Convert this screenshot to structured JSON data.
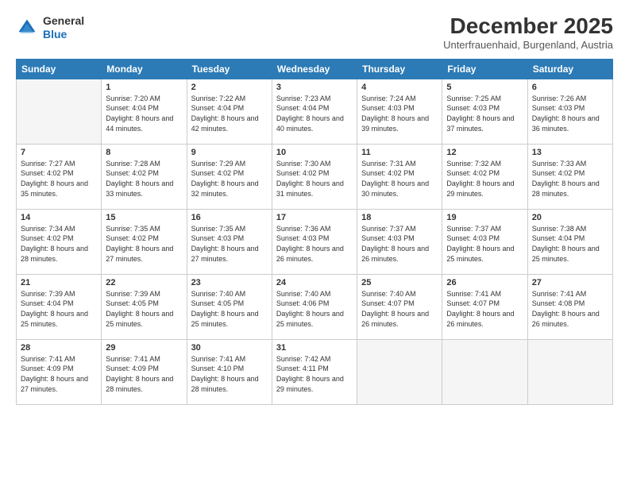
{
  "header": {
    "logo_general": "General",
    "logo_blue": "Blue",
    "month_title": "December 2025",
    "subtitle": "Unterfrauenhaid, Burgenland, Austria"
  },
  "days_of_week": [
    "Sunday",
    "Monday",
    "Tuesday",
    "Wednesday",
    "Thursday",
    "Friday",
    "Saturday"
  ],
  "weeks": [
    [
      {
        "day": "",
        "content": ""
      },
      {
        "day": "1",
        "sunrise": "Sunrise: 7:20 AM",
        "sunset": "Sunset: 4:04 PM",
        "daylight": "Daylight: 8 hours and 44 minutes."
      },
      {
        "day": "2",
        "sunrise": "Sunrise: 7:22 AM",
        "sunset": "Sunset: 4:04 PM",
        "daylight": "Daylight: 8 hours and 42 minutes."
      },
      {
        "day": "3",
        "sunrise": "Sunrise: 7:23 AM",
        "sunset": "Sunset: 4:04 PM",
        "daylight": "Daylight: 8 hours and 40 minutes."
      },
      {
        "day": "4",
        "sunrise": "Sunrise: 7:24 AM",
        "sunset": "Sunset: 4:03 PM",
        "daylight": "Daylight: 8 hours and 39 minutes."
      },
      {
        "day": "5",
        "sunrise": "Sunrise: 7:25 AM",
        "sunset": "Sunset: 4:03 PM",
        "daylight": "Daylight: 8 hours and 37 minutes."
      },
      {
        "day": "6",
        "sunrise": "Sunrise: 7:26 AM",
        "sunset": "Sunset: 4:03 PM",
        "daylight": "Daylight: 8 hours and 36 minutes."
      }
    ],
    [
      {
        "day": "7",
        "sunrise": "Sunrise: 7:27 AM",
        "sunset": "Sunset: 4:02 PM",
        "daylight": "Daylight: 8 hours and 35 minutes."
      },
      {
        "day": "8",
        "sunrise": "Sunrise: 7:28 AM",
        "sunset": "Sunset: 4:02 PM",
        "daylight": "Daylight: 8 hours and 33 minutes."
      },
      {
        "day": "9",
        "sunrise": "Sunrise: 7:29 AM",
        "sunset": "Sunset: 4:02 PM",
        "daylight": "Daylight: 8 hours and 32 minutes."
      },
      {
        "day": "10",
        "sunrise": "Sunrise: 7:30 AM",
        "sunset": "Sunset: 4:02 PM",
        "daylight": "Daylight: 8 hours and 31 minutes."
      },
      {
        "day": "11",
        "sunrise": "Sunrise: 7:31 AM",
        "sunset": "Sunset: 4:02 PM",
        "daylight": "Daylight: 8 hours and 30 minutes."
      },
      {
        "day": "12",
        "sunrise": "Sunrise: 7:32 AM",
        "sunset": "Sunset: 4:02 PM",
        "daylight": "Daylight: 8 hours and 29 minutes."
      },
      {
        "day": "13",
        "sunrise": "Sunrise: 7:33 AM",
        "sunset": "Sunset: 4:02 PM",
        "daylight": "Daylight: 8 hours and 28 minutes."
      }
    ],
    [
      {
        "day": "14",
        "sunrise": "Sunrise: 7:34 AM",
        "sunset": "Sunset: 4:02 PM",
        "daylight": "Daylight: 8 hours and 28 minutes."
      },
      {
        "day": "15",
        "sunrise": "Sunrise: 7:35 AM",
        "sunset": "Sunset: 4:02 PM",
        "daylight": "Daylight: 8 hours and 27 minutes."
      },
      {
        "day": "16",
        "sunrise": "Sunrise: 7:35 AM",
        "sunset": "Sunset: 4:03 PM",
        "daylight": "Daylight: 8 hours and 27 minutes."
      },
      {
        "day": "17",
        "sunrise": "Sunrise: 7:36 AM",
        "sunset": "Sunset: 4:03 PM",
        "daylight": "Daylight: 8 hours and 26 minutes."
      },
      {
        "day": "18",
        "sunrise": "Sunrise: 7:37 AM",
        "sunset": "Sunset: 4:03 PM",
        "daylight": "Daylight: 8 hours and 26 minutes."
      },
      {
        "day": "19",
        "sunrise": "Sunrise: 7:37 AM",
        "sunset": "Sunset: 4:03 PM",
        "daylight": "Daylight: 8 hours and 25 minutes."
      },
      {
        "day": "20",
        "sunrise": "Sunrise: 7:38 AM",
        "sunset": "Sunset: 4:04 PM",
        "daylight": "Daylight: 8 hours and 25 minutes."
      }
    ],
    [
      {
        "day": "21",
        "sunrise": "Sunrise: 7:39 AM",
        "sunset": "Sunset: 4:04 PM",
        "daylight": "Daylight: 8 hours and 25 minutes."
      },
      {
        "day": "22",
        "sunrise": "Sunrise: 7:39 AM",
        "sunset": "Sunset: 4:05 PM",
        "daylight": "Daylight: 8 hours and 25 minutes."
      },
      {
        "day": "23",
        "sunrise": "Sunrise: 7:40 AM",
        "sunset": "Sunset: 4:05 PM",
        "daylight": "Daylight: 8 hours and 25 minutes."
      },
      {
        "day": "24",
        "sunrise": "Sunrise: 7:40 AM",
        "sunset": "Sunset: 4:06 PM",
        "daylight": "Daylight: 8 hours and 25 minutes."
      },
      {
        "day": "25",
        "sunrise": "Sunrise: 7:40 AM",
        "sunset": "Sunset: 4:07 PM",
        "daylight": "Daylight: 8 hours and 26 minutes."
      },
      {
        "day": "26",
        "sunrise": "Sunrise: 7:41 AM",
        "sunset": "Sunset: 4:07 PM",
        "daylight": "Daylight: 8 hours and 26 minutes."
      },
      {
        "day": "27",
        "sunrise": "Sunrise: 7:41 AM",
        "sunset": "Sunset: 4:08 PM",
        "daylight": "Daylight: 8 hours and 26 minutes."
      }
    ],
    [
      {
        "day": "28",
        "sunrise": "Sunrise: 7:41 AM",
        "sunset": "Sunset: 4:09 PM",
        "daylight": "Daylight: 8 hours and 27 minutes."
      },
      {
        "day": "29",
        "sunrise": "Sunrise: 7:41 AM",
        "sunset": "Sunset: 4:09 PM",
        "daylight": "Daylight: 8 hours and 28 minutes."
      },
      {
        "day": "30",
        "sunrise": "Sunrise: 7:41 AM",
        "sunset": "Sunset: 4:10 PM",
        "daylight": "Daylight: 8 hours and 28 minutes."
      },
      {
        "day": "31",
        "sunrise": "Sunrise: 7:42 AM",
        "sunset": "Sunset: 4:11 PM",
        "daylight": "Daylight: 8 hours and 29 minutes."
      },
      {
        "day": "",
        "content": ""
      },
      {
        "day": "",
        "content": ""
      },
      {
        "day": "",
        "content": ""
      }
    ]
  ]
}
